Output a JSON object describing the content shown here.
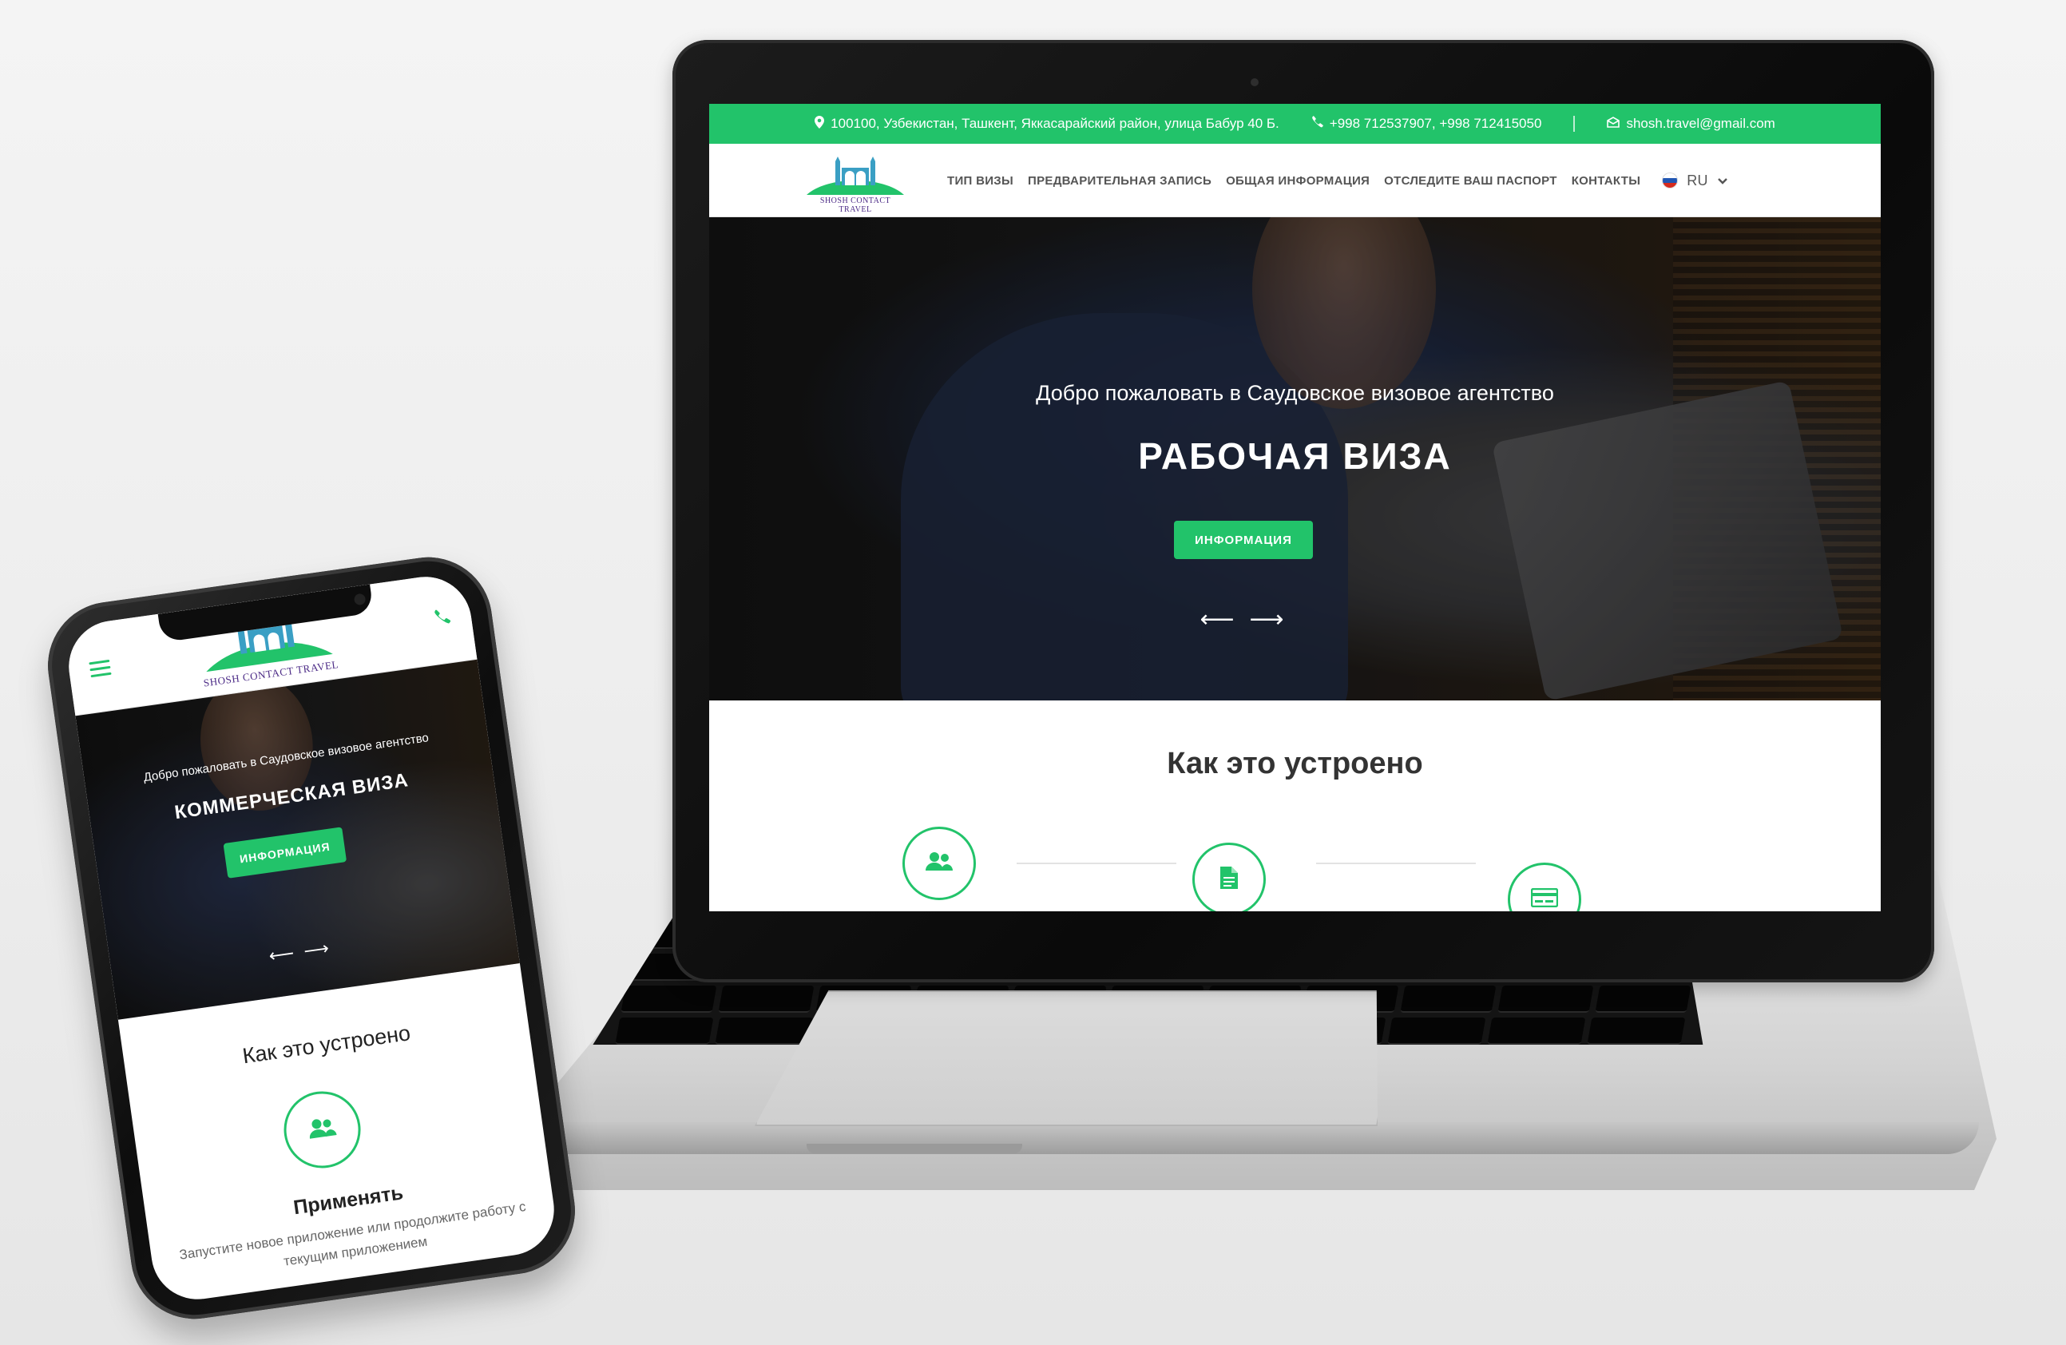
{
  "colors": {
    "accent": "#22c36a",
    "logo_text": "#4b2a86",
    "nav_text": "#555555",
    "heading": "#333333",
    "device_frame": "#0d0d0d"
  },
  "brand": {
    "logo_text": "SHOSH CONTACT TRAVEL"
  },
  "desktop": {
    "topbar": {
      "address": "100100, Узбекистан, Ташкент, Яккасарайский район, улица Бабур 40 Б.",
      "phones": "+998 712537907,   +998 712415050",
      "email": "shosh.travel@gmail.com",
      "icons": [
        "map-marker-icon",
        "phone-icon",
        "envelope-icon"
      ]
    },
    "nav": {
      "items": [
        "ТИП ВИЗЫ",
        "ПРЕДВАРИТЕЛЬНАЯ ЗАПИСЬ",
        "ОБЩАЯ ИНФОРМАЦИЯ",
        "ОТСЛЕДИТЕ ВАШ ПАСПОРТ",
        "КОНТАКТЫ"
      ],
      "language": "RU"
    },
    "hero": {
      "subtitle": "Добро пожаловать в Саудовское визовое агентство",
      "title": "РАБОЧАЯ ВИЗА",
      "button": "ИНФОРМАЦИЯ",
      "prev_arrow": "⟵",
      "next_arrow": "⟶"
    },
    "how": {
      "title": "Как это устроено",
      "step_icons": [
        "users-icon",
        "document-icon",
        "credit-card-icon"
      ]
    }
  },
  "mobile": {
    "hero": {
      "subtitle": "Добро пожаловать в Саудовское визовое агентство",
      "title": "КОММЕРЧЕСКАЯ ВИЗА",
      "button": "ИНФОРМАЦИЯ",
      "prev_arrow": "⟵",
      "next_arrow": "⟶"
    },
    "how": {
      "title": "Как это устроено",
      "step_title": "Применять",
      "step_desc": "Запустите новое приложение или продолжите работу с текущим приложением",
      "step_icon": "users-icon"
    },
    "header_icons": [
      "menu-icon",
      "phone-icon"
    ]
  }
}
